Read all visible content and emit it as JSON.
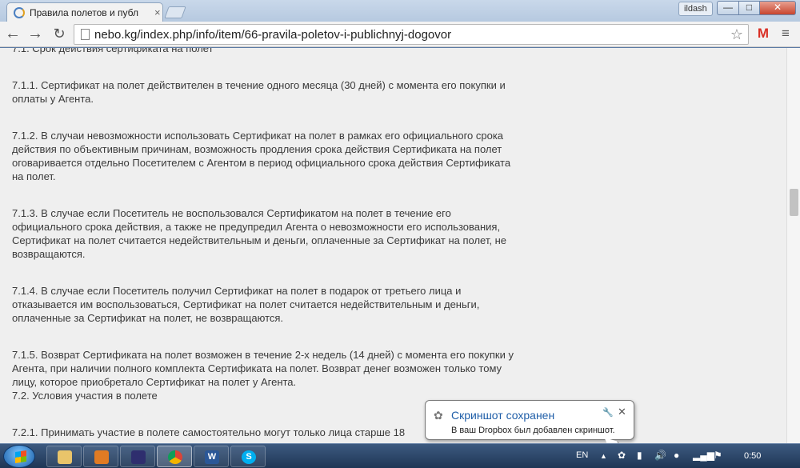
{
  "window": {
    "tab_title": "Правила полетов и публ",
    "tab_close": "×",
    "user_badge": "ildash",
    "min_glyph": "—",
    "max_glyph": "□",
    "close_glyph": "✕"
  },
  "toolbar": {
    "back": "←",
    "forward": "→",
    "reload": "↻",
    "url": "nebo.kg/index.php/info/item/66-pravila-poletov-i-publichnyj-dogovor",
    "star": "☆",
    "gmail": "M",
    "menu": "≡"
  },
  "article": {
    "paragraphs": [
      "7.1. Срок действия сертификата на полет",
      "7.1.1. Сертификат на полет действителен в течение одного месяца (30 дней) с момента его покупки и оплаты у Агента.",
      "7.1.2. В случаи невозможности использовать Сертификат на полет в рамках его официального срока действия по объективным причинам, возможность продления срока действия Сертификата на полет оговаривается отдельно Посетителем с Агентом в период официального срока действия Сертификата на полет.",
      "7.1.3. В случае если Посетитель не воспользовался Сертификатом на полет в течение его официального срока действия, а также не предупредил Агента о невозможности его использования, Сертификат на полет считается недействительным и деньги, оплаченные за Сертификат на полет, не возвращаются.",
      "7.1.4. В случае если Посетитель получил Сертификат на полет в подарок от третьего лица и отказывается им воспользоваться, Сертификат на полет считается недействительным и деньги, оплаченные за Сертификат на полет, не возвращаются.",
      "7.1.5. Возврат Сертификата на полет возможен в течение 2-х недель (14 дней) с момента его покупки у Агента, при наличии полного комплекта Сертификата на полет. Возврат денег возможен только тому лицу, которое приобретало Сертификат на полет у Агента.",
      "7.2. Условия участия в полете",
      "7.2.1. Принимать участие в полете самостоятельно могут только лица старше 18"
    ]
  },
  "notification": {
    "title": "Скриншот сохранен",
    "body": "В ваш Dropbox был добавлен скриншот.",
    "pin": "🔧",
    "close": "✕",
    "icon": "✿"
  },
  "taskbar": {
    "word_glyph": "W",
    "skype_glyph": "S",
    "lang": "EN",
    "tray_arrow": "▲",
    "clock": "0:50"
  },
  "colors": {
    "link_blue": "#1f5ea8",
    "gmail_red": "#d93025"
  }
}
